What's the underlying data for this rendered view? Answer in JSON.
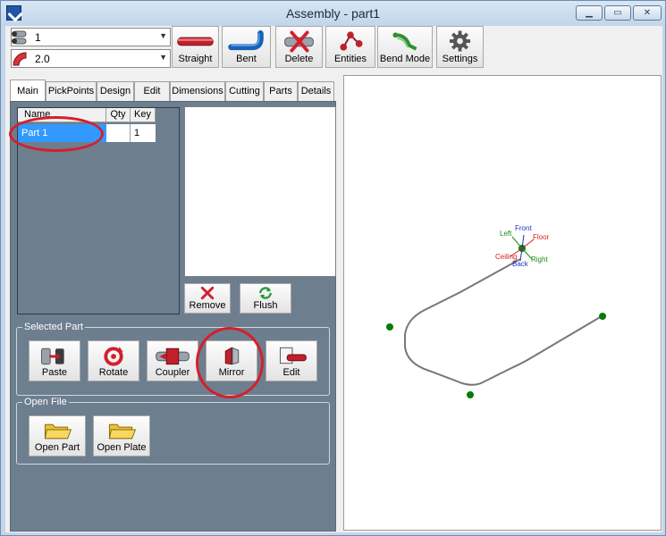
{
  "window": {
    "title": "Assembly - part1"
  },
  "toolbar": {
    "combo1_value": "1",
    "combo2_value": "2.0",
    "buttons": [
      {
        "label": "Straight",
        "icon": "straight-pipe-icon"
      },
      {
        "label": "Bent",
        "icon": "bent-pipe-icon"
      },
      {
        "label": "Delete",
        "icon": "delete-icon"
      },
      {
        "label": "Entities",
        "icon": "entities-icon"
      },
      {
        "label": "Bend Mode",
        "icon": "bend-mode-icon"
      },
      {
        "label": "Settings",
        "icon": "gear-icon"
      }
    ]
  },
  "tabs": [
    "Main",
    "PickPoints",
    "Design",
    "Edit",
    "Dimensions",
    "Cutting",
    "Parts",
    "Details"
  ],
  "active_tab": "Main",
  "parts_grid": {
    "columns": [
      "Name",
      "Qty",
      "Key"
    ],
    "rows": [
      {
        "name": "Part 1",
        "qty": "",
        "key": "1"
      }
    ]
  },
  "list_actions": {
    "remove": "Remove",
    "flush": "Flush"
  },
  "selected_part": {
    "title": "Selected Part",
    "buttons": [
      "Paste",
      "Rotate",
      "Coupler",
      "Mirror",
      "Edit"
    ]
  },
  "open_file": {
    "title": "Open File",
    "buttons": [
      "Open Part",
      "Open Plate"
    ]
  },
  "viewport": {
    "orientation_labels": {
      "front": "Front",
      "left": "Left",
      "floor": "Floor",
      "ceiling": "Ceiling",
      "right": "Right",
      "back": "Back"
    }
  },
  "colors": {
    "accent_red": "#d2202c",
    "selection": "#3399ff",
    "panel": "#6d7e8f",
    "node_green": "#0a7a0a"
  }
}
